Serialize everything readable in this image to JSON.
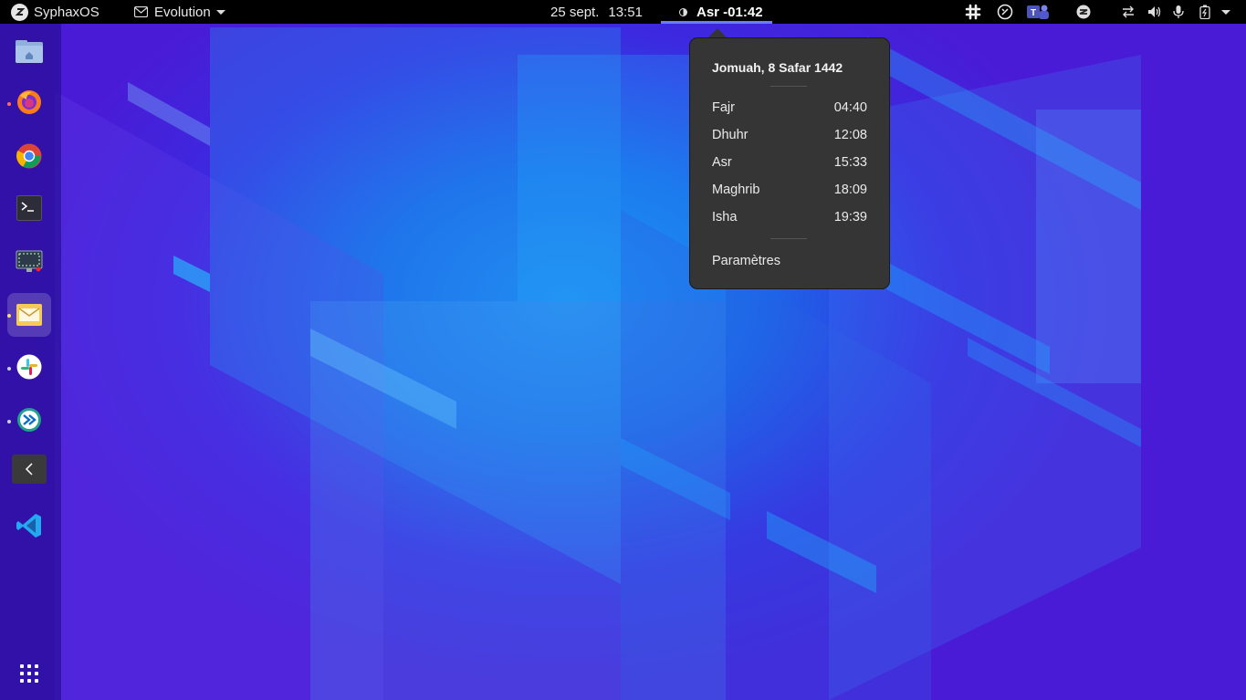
{
  "topbar": {
    "activities_label": "SyphaxOS",
    "app_menu_label": "Evolution",
    "date_label": "25 sept.",
    "time_label": "13:51",
    "prayer_indicator": "Asr -01:42"
  },
  "prayer_popup": {
    "title": "Jomuah, 8 Safar 1442",
    "prayers": [
      {
        "name": "Fajr",
        "time": "04:40"
      },
      {
        "name": "Dhuhr",
        "time": "12:08"
      },
      {
        "name": "Asr",
        "time": "15:33"
      },
      {
        "name": "Maghrib",
        "time": "18:09"
      },
      {
        "name": "Isha",
        "time": "19:39"
      }
    ],
    "settings_label": "Paramètres"
  },
  "dock": {
    "items": [
      {
        "icon": "files-icon"
      },
      {
        "icon": "firefox-icon"
      },
      {
        "icon": "chrome-icon"
      },
      {
        "icon": "terminal-icon"
      },
      {
        "icon": "screenshot-icon"
      },
      {
        "icon": "evolution-mail-icon"
      },
      {
        "icon": "slack-icon"
      },
      {
        "icon": "remote-desktop-icon"
      },
      {
        "icon": "collapse-icon"
      },
      {
        "icon": "vscode-icon"
      }
    ],
    "show_apps_icon": "grid-icon"
  },
  "colors": {
    "accent": "#6c7bff",
    "popup_bg": "#353535",
    "topbar_bg": "#000000"
  }
}
